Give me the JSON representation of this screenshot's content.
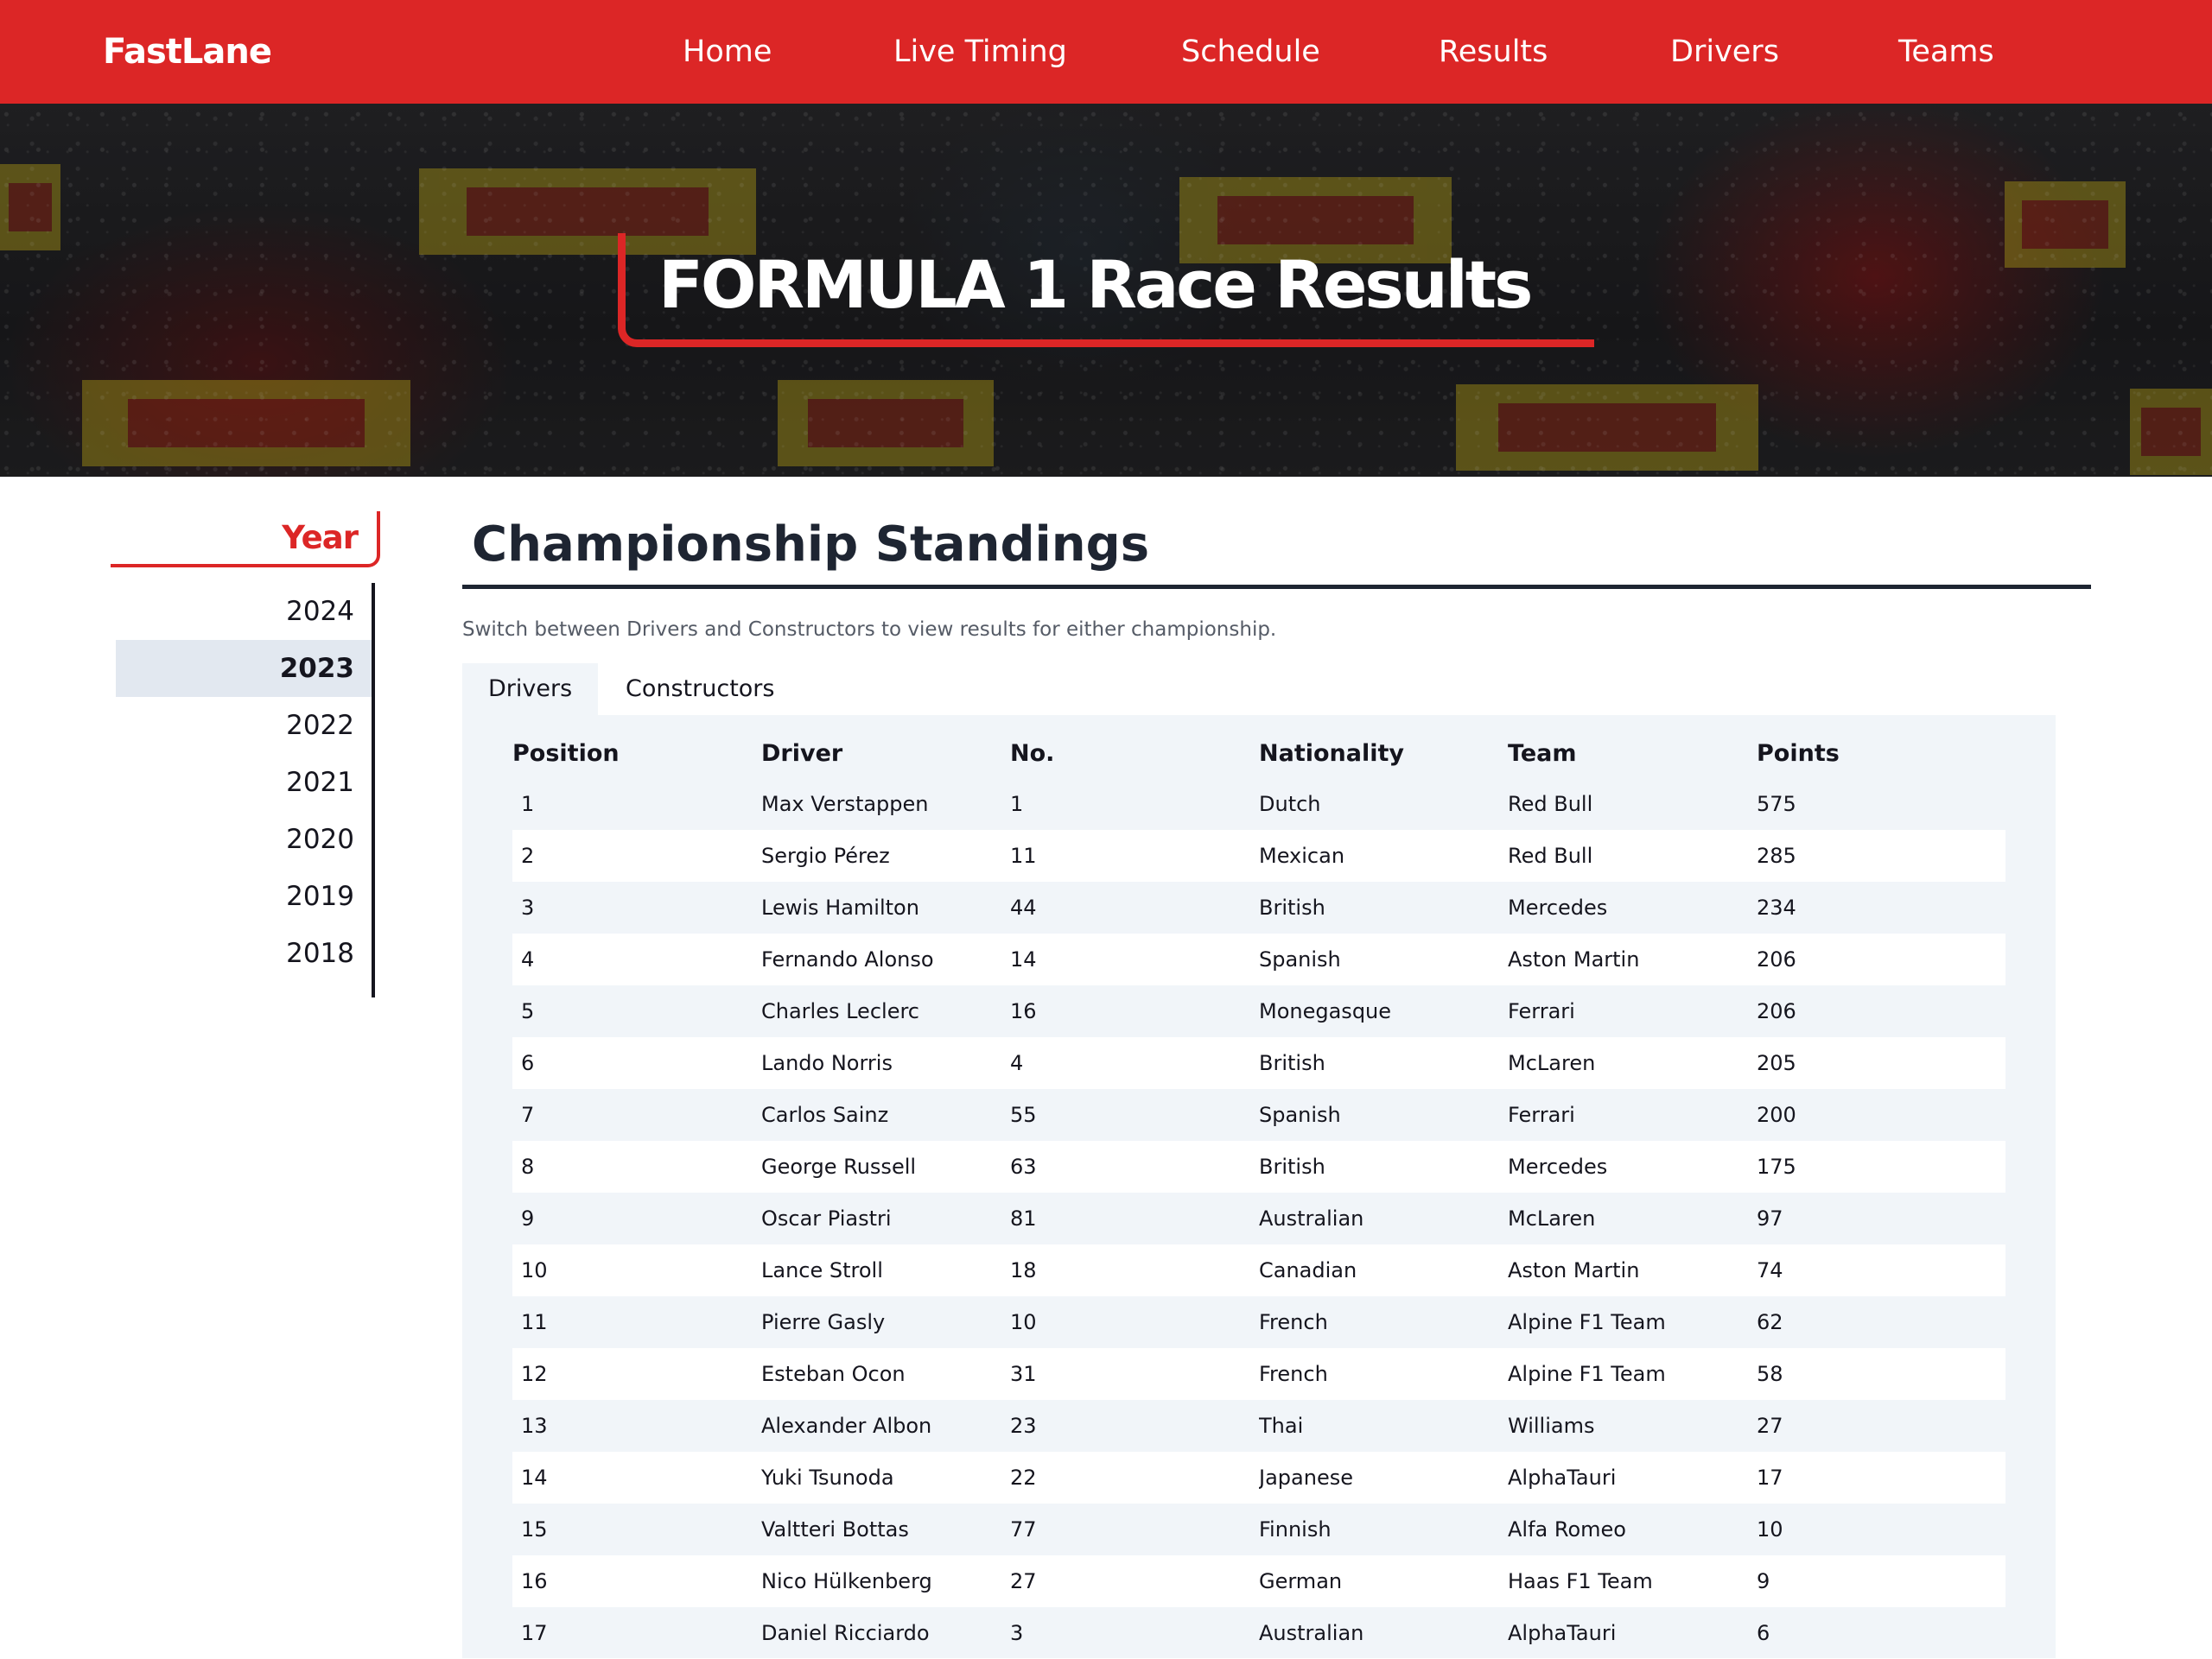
{
  "brand": "FastLane",
  "nav": {
    "items": [
      {
        "label": "Home"
      },
      {
        "label": "Live Timing"
      },
      {
        "label": "Schedule"
      },
      {
        "label": "Results"
      },
      {
        "label": "Drivers"
      },
      {
        "label": "Teams"
      }
    ]
  },
  "hero": {
    "title": "FORMULA 1 Race Results"
  },
  "sidebar": {
    "heading": "Year",
    "years": [
      "2024",
      "2023",
      "2022",
      "2021",
      "2020",
      "2019",
      "2018"
    ],
    "selected": "2023"
  },
  "main": {
    "title": "Championship Standings",
    "subtitle": "Switch between Drivers and Constructors to view results for either championship.",
    "tabs": [
      {
        "label": "Drivers",
        "active": true
      },
      {
        "label": "Constructors",
        "active": false
      }
    ],
    "table": {
      "columns": [
        "Position",
        "Driver",
        "No.",
        "Nationality",
        "Team",
        "Points"
      ],
      "rows": [
        [
          "1",
          "Max Verstappen",
          "1",
          "Dutch",
          "Red Bull",
          "575"
        ],
        [
          "2",
          "Sergio Pérez",
          "11",
          "Mexican",
          "Red Bull",
          "285"
        ],
        [
          "3",
          "Lewis Hamilton",
          "44",
          "British",
          "Mercedes",
          "234"
        ],
        [
          "4",
          "Fernando Alonso",
          "14",
          "Spanish",
          "Aston Martin",
          "206"
        ],
        [
          "5",
          "Charles Leclerc",
          "16",
          "Monegasque",
          "Ferrari",
          "206"
        ],
        [
          "6",
          "Lando Norris",
          "4",
          "British",
          "McLaren",
          "205"
        ],
        [
          "7",
          "Carlos Sainz",
          "55",
          "Spanish",
          "Ferrari",
          "200"
        ],
        [
          "8",
          "George Russell",
          "63",
          "British",
          "Mercedes",
          "175"
        ],
        [
          "9",
          "Oscar Piastri",
          "81",
          "Australian",
          "McLaren",
          "97"
        ],
        [
          "10",
          "Lance Stroll",
          "18",
          "Canadian",
          "Aston Martin",
          "74"
        ],
        [
          "11",
          "Pierre Gasly",
          "10",
          "French",
          "Alpine F1 Team",
          "62"
        ],
        [
          "12",
          "Esteban Ocon",
          "31",
          "French",
          "Alpine F1 Team",
          "58"
        ],
        [
          "13",
          "Alexander Albon",
          "23",
          "Thai",
          "Williams",
          "27"
        ],
        [
          "14",
          "Yuki Tsunoda",
          "22",
          "Japanese",
          "AlphaTauri",
          "17"
        ],
        [
          "15",
          "Valtteri Bottas",
          "77",
          "Finnish",
          "Alfa Romeo",
          "10"
        ],
        [
          "16",
          "Nico Hülkenberg",
          "27",
          "German",
          "Haas F1 Team",
          "9"
        ],
        [
          "17",
          "Daniel Ricciardo",
          "3",
          "Australian",
          "AlphaTauri",
          "6"
        ]
      ]
    }
  },
  "colors": {
    "accent": "#dc2626",
    "dark": "#1e2532",
    "panel": "#f1f5f9",
    "selected_year_bg": "#e2e8f0"
  }
}
